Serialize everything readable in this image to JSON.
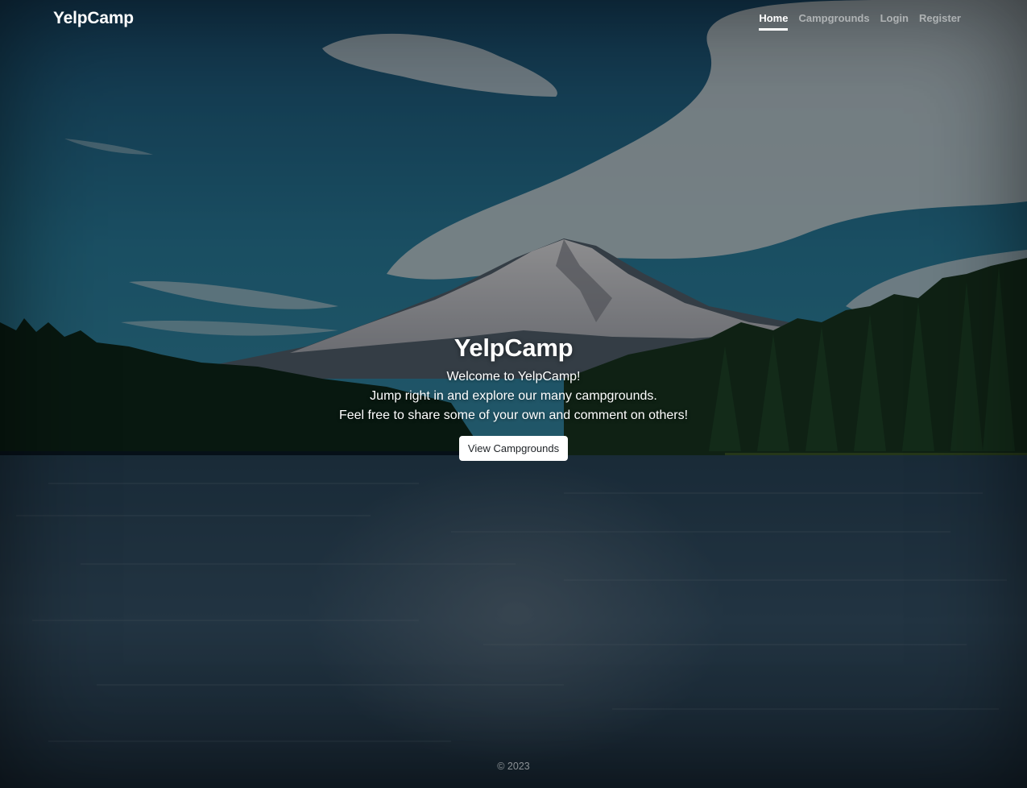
{
  "navbar": {
    "brand": "YelpCamp",
    "links": [
      {
        "label": "Home",
        "active": true
      },
      {
        "label": "Campgrounds",
        "active": false
      },
      {
        "label": "Login",
        "active": false
      },
      {
        "label": "Register",
        "active": false
      }
    ]
  },
  "hero": {
    "title": "YelpCamp",
    "lines": [
      "Welcome to YelpCamp!",
      "Jump right in and explore our many campgrounds.",
      "Feel free to share some of your own and comment on others!"
    ],
    "cta_label": "View Campgrounds"
  },
  "footer": {
    "text": "© 2023"
  },
  "colors": {
    "sky_top": "#1a4a6a",
    "sky_bottom": "#2b7fa0",
    "forest": "#0f2a1c",
    "water": "#1c3346",
    "button_bg": "#ffffff",
    "button_text": "#212529"
  }
}
